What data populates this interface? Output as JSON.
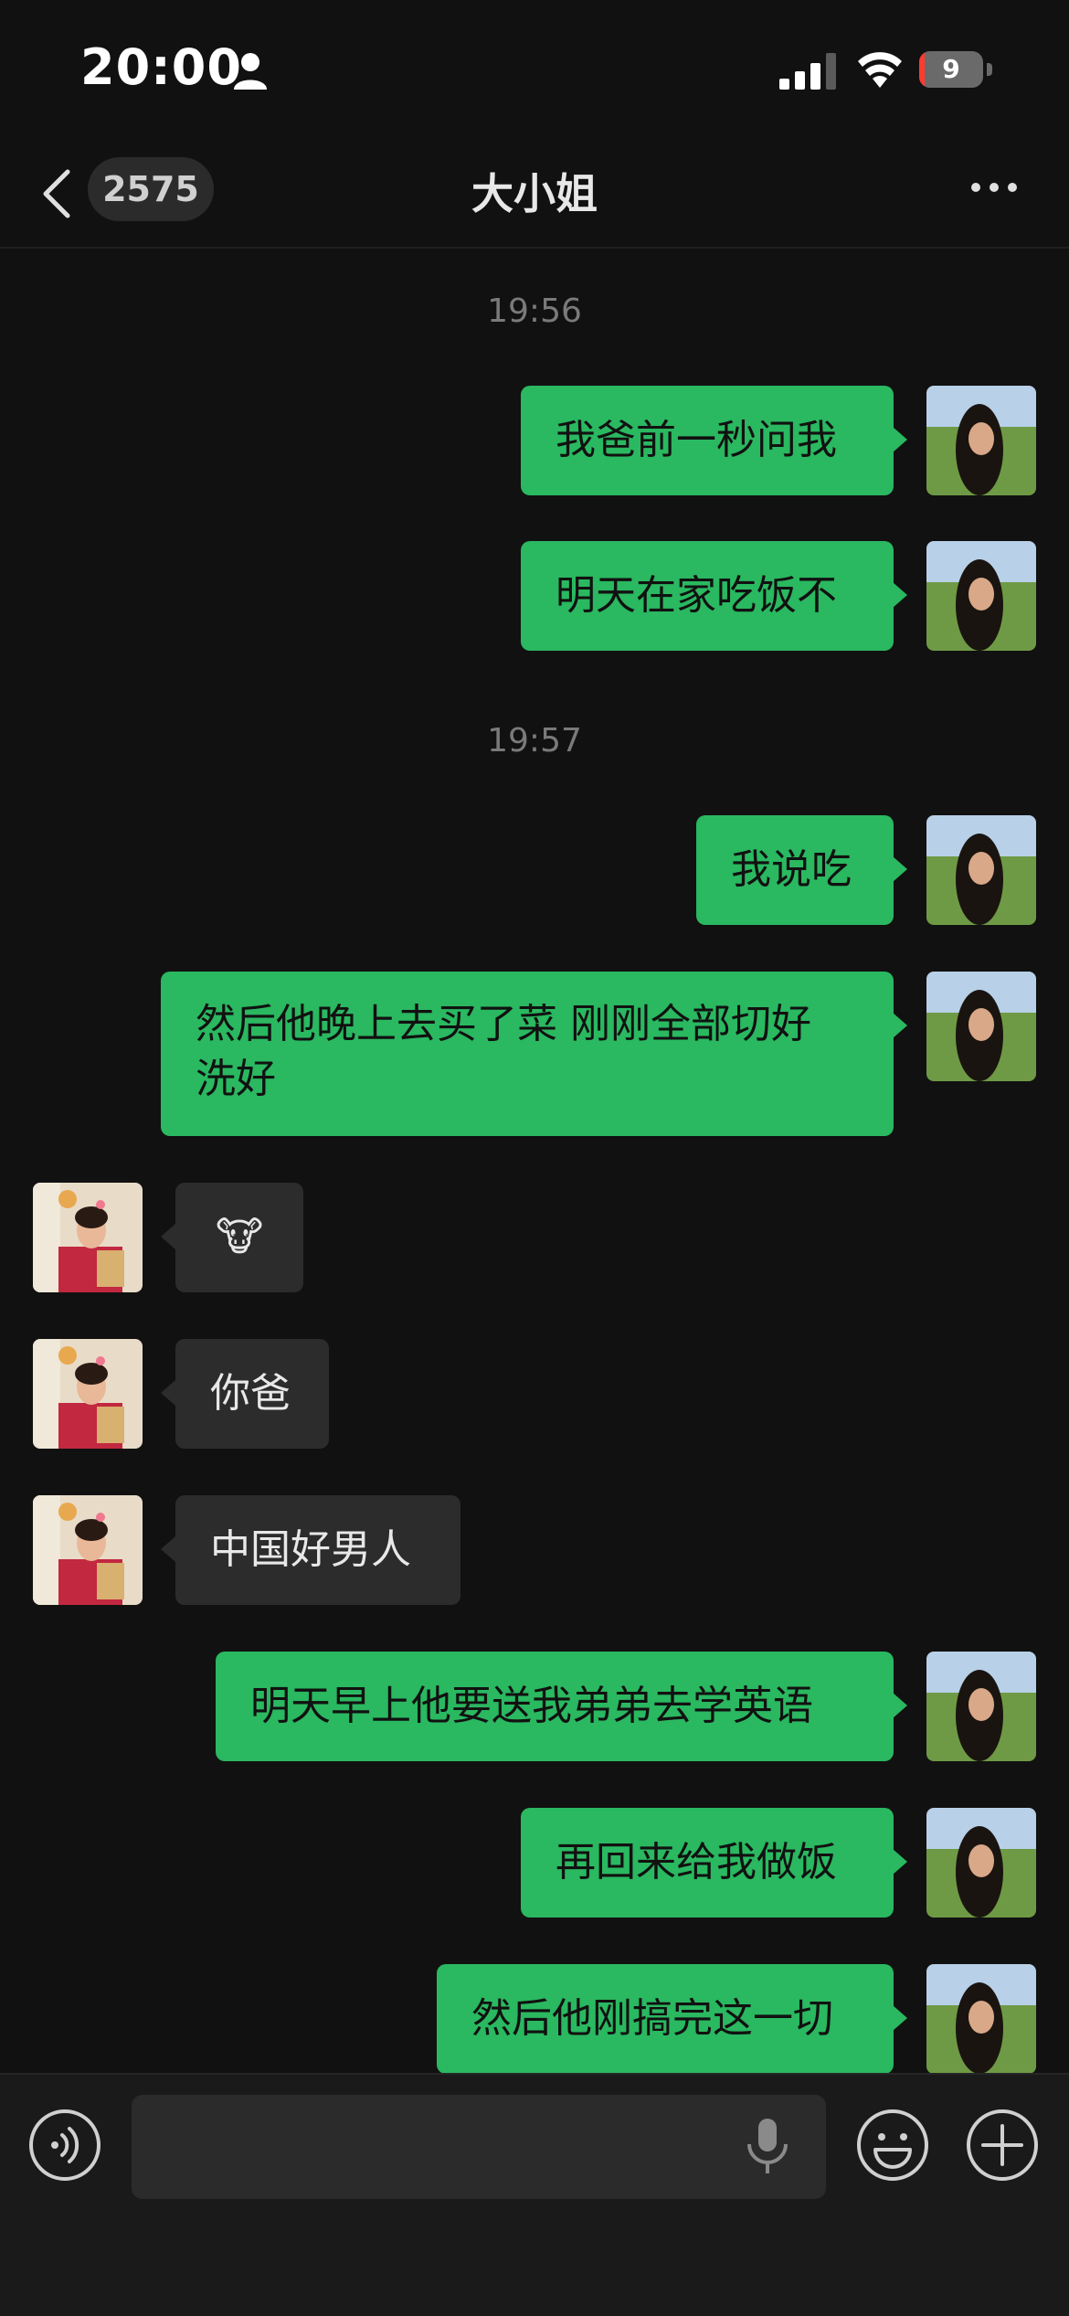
{
  "status_bar": {
    "time": "20:00",
    "battery_level": "9",
    "battery_fraction": 0.09
  },
  "nav": {
    "unread_count": "2575",
    "title": "大小姐"
  },
  "timestamps": [
    "19:56",
    "19:57"
  ],
  "messages": [
    {
      "side": "out",
      "text": "我爸前一秒问我"
    },
    {
      "side": "out",
      "text": "明天在家吃饭不"
    },
    {
      "side": "out",
      "text": "我说吃"
    },
    {
      "side": "out",
      "text_line1": "然后他晚上去买了菜 刚刚全部切好",
      "text_line2": "洗好"
    },
    {
      "side": "in",
      "text": "🐮"
    },
    {
      "side": "in",
      "text": "你爸"
    },
    {
      "side": "in",
      "text": "中国好男人"
    },
    {
      "side": "out",
      "text": "明天早上他要送我弟弟去学英语"
    },
    {
      "side": "out",
      "text": "再回来给我做饭"
    },
    {
      "side": "out",
      "text": "然后他刚搞完这一切"
    }
  ],
  "input": {
    "placeholder": ""
  },
  "colors": {
    "outgoing_bubble": "#2ab860",
    "incoming_bubble": "#2c2c2c",
    "background": "#111111"
  }
}
